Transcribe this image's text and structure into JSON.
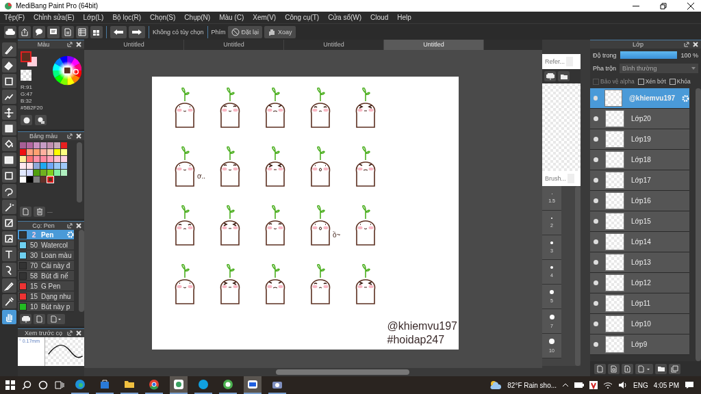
{
  "window": {
    "title": "MediBang Paint Pro (64bit)"
  },
  "menu": [
    "Tệp(F)",
    "Chỉnh sửa(E)",
    "Lớp(L)",
    "Bộ lọc(R)",
    "Chọn(S)",
    "Chụp(N)",
    "Màu (C)",
    "Xem(V)",
    "Công cụ(T)",
    "Cửa sổ(W)",
    "Cloud",
    "Help"
  ],
  "toolbar": {
    "option_text": "Không có tùy chọn",
    "key_label": "Phím",
    "reset_button": "Đặt lại",
    "rotate_button": "Xoay"
  },
  "document_tabs": [
    {
      "label": "Untitled",
      "selected": false
    },
    {
      "label": "Untitled",
      "selected": false
    },
    {
      "label": "Untitled",
      "selected": false
    },
    {
      "label": "Untitled",
      "selected": true
    }
  ],
  "tools": [
    {
      "kind": "brush",
      "selected": false
    },
    {
      "kind": "eraser",
      "selected": false
    },
    {
      "kind": "square",
      "selected": false
    },
    {
      "kind": "polyline",
      "selected": false
    },
    {
      "kind": "move",
      "selected": false
    },
    {
      "kind": "filled",
      "selected": false
    },
    {
      "kind": "bucket",
      "selected": false
    },
    {
      "kind": "gradient",
      "selected": false
    },
    {
      "kind": "selection",
      "selected": false
    },
    {
      "kind": "lasso",
      "selected": false
    },
    {
      "kind": "wand",
      "selected": false
    },
    {
      "kind": "selectpen",
      "selected": false
    },
    {
      "kind": "selecteraser",
      "selected": false
    },
    {
      "kind": "text",
      "selected": false
    },
    {
      "kind": "pointer",
      "selected": false
    },
    {
      "kind": "knife",
      "selected": false
    },
    {
      "kind": "dropper",
      "selected": false
    },
    {
      "kind": "hand",
      "selected": true
    }
  ],
  "color_panel": {
    "title": "Màu",
    "rgb": [
      "R:91",
      "G:47",
      "B:32"
    ],
    "hex": "#5B2F20"
  },
  "palette_panel": {
    "title": "Bảng màu",
    "footer": "---",
    "swatches": [
      {
        "color": "#a65f95",
        "selected": false
      },
      {
        "color": "#b266a0",
        "selected": false
      },
      {
        "color": "#c98fbf",
        "selected": false
      },
      {
        "color": "#c59bc4",
        "selected": false
      },
      {
        "color": "#c08fb0",
        "selected": false
      },
      {
        "color": "#c8a8b8",
        "selected": false
      },
      {
        "color": "#e82020",
        "selected": false
      },
      {
        "color": "#ee1111",
        "selected": false
      },
      {
        "color": "#ffa080",
        "selected": false
      },
      {
        "color": "#ffa070",
        "selected": false
      },
      {
        "color": "#ffb0a0",
        "selected": false
      },
      {
        "color": "#ffd0b0",
        "selected": false
      },
      {
        "color": "#ffff00",
        "selected": false
      },
      {
        "color": "#ffff80",
        "selected": false
      },
      {
        "color": "#ffee99",
        "selected": false
      },
      {
        "color": "#ff7070",
        "selected": false
      },
      {
        "color": "#ff90a8",
        "selected": false
      },
      {
        "color": "#ff88a0",
        "selected": false
      },
      {
        "color": "#ffa0b8",
        "selected": false
      },
      {
        "color": "#ffc0d0",
        "selected": false
      },
      {
        "color": "#ffd0e0",
        "selected": false
      },
      {
        "color": "#ffe8f0",
        "selected": false
      },
      {
        "color": "#ffe0e8",
        "selected": false
      },
      {
        "color": "#8ea8d8",
        "selected": false
      },
      {
        "color": "#20a8f0",
        "selected": false
      },
      {
        "color": "#70a8f8",
        "selected": false
      },
      {
        "color": "#98c8f8",
        "selected": false
      },
      {
        "color": "#a0c8f8",
        "selected": false
      },
      {
        "color": "#e0e8ff",
        "selected": false
      },
      {
        "color": "#d0d8ff",
        "selected": false
      },
      {
        "color": "#50a010",
        "selected": false
      },
      {
        "color": "#70b020",
        "selected": false
      },
      {
        "color": "#80d020",
        "selected": false
      },
      {
        "color": "#80f0a0",
        "selected": false
      },
      {
        "color": "#b0f0c0",
        "selected": false
      },
      {
        "color": "#ffffff",
        "selected": false
      },
      {
        "color": "#000000",
        "selected": false
      },
      {
        "color": "#808080",
        "selected": false
      },
      {
        "color": "#603028",
        "selected": false
      },
      {
        "color": "#5b2f20",
        "selected": true
      }
    ]
  },
  "brush_panel": {
    "title": "Cọ: Pen",
    "brushes": [
      {
        "size": "2",
        "name": "Pen",
        "color": "#333333",
        "selected": true
      },
      {
        "size": "50",
        "name": "Watercol",
        "color": "#6fd0f0",
        "selected": false
      },
      {
        "size": "30",
        "name": "Loan màu",
        "color": "#6fd0f0",
        "selected": false
      },
      {
        "size": "70",
        "name": "Cái này đ",
        "color": "#333333",
        "selected": false
      },
      {
        "size": "58",
        "name": "Bút đi nế",
        "color": "#333333",
        "selected": false
      },
      {
        "size": "15",
        "name": "G Pen",
        "color": "#ee3333",
        "selected": false
      },
      {
        "size": "15",
        "name": "Dạng nhu",
        "color": "#ee3333",
        "selected": false
      },
      {
        "size": "10",
        "name": "Bút này p",
        "color": "#22bb22",
        "selected": false
      }
    ]
  },
  "brush_preview": {
    "title": "Xem trước cọ",
    "size": "° 0.17mm"
  },
  "reference_panel": {
    "title": "Refer..."
  },
  "brush_size_panel": {
    "title": "Brush...",
    "sizes": [
      "1.5",
      "2",
      "3",
      "4",
      "5",
      "7",
      "10"
    ]
  },
  "canvas": {
    "figures": [
      {
        "kind": "smile"
      },
      {
        "kind": "blush"
      },
      {
        "kind": "angry"
      },
      {
        "kind": "sad"
      },
      {
        "kind": "squint"
      },
      {
        "kind": "smile",
        "caption": "ơ.."
      },
      {
        "kind": "blush"
      },
      {
        "kind": "squint"
      },
      {
        "kind": "surprised"
      },
      {
        "kind": "angry"
      },
      {
        "kind": "sad"
      },
      {
        "kind": "squint"
      },
      {
        "kind": "blush"
      },
      {
        "kind": "surprised",
        "caption": "ồ~"
      },
      {
        "kind": "smile"
      },
      {
        "kind": "smile"
      },
      {
        "kind": "squint"
      },
      {
        "kind": "angry"
      },
      {
        "kind": "sad"
      },
      {
        "kind": "squint"
      }
    ],
    "signature": [
      "@khiemvu197",
      "#hoidap247"
    ]
  },
  "layer_panel": {
    "title": "Lớp",
    "opacity_label": "Độ trong",
    "opacity": {
      "level": 1
    },
    "opacity_value": "100 %",
    "blend_label": "Pha trộn",
    "blend_value": "Bình thường",
    "options": [
      {
        "label": "Bảo vệ alpha",
        "checked": false,
        "disabled": true
      },
      {
        "label": "Xén bớt",
        "checked": false,
        "disabled": false
      },
      {
        "label": "Khóa",
        "checked": false,
        "disabled": false
      }
    ],
    "layers": [
      {
        "name": "@khiemvu197",
        "selected": true,
        "visible": true
      },
      {
        "name": "Lớp20",
        "selected": false,
        "visible": true
      },
      {
        "name": "Lớp19",
        "selected": false,
        "visible": true
      },
      {
        "name": "Lớp18",
        "selected": false,
        "visible": true
      },
      {
        "name": "Lớp17",
        "selected": false,
        "visible": true
      },
      {
        "name": "Lớp16",
        "selected": false,
        "visible": true
      },
      {
        "name": "Lớp15",
        "selected": false,
        "visible": true
      },
      {
        "name": "Lớp14",
        "selected": false,
        "visible": true
      },
      {
        "name": "Lớp13",
        "selected": false,
        "visible": true
      },
      {
        "name": "Lớp12",
        "selected": false,
        "visible": true
      },
      {
        "name": "Lớp11",
        "selected": false,
        "visible": true
      },
      {
        "name": "Lớp10",
        "selected": false,
        "visible": true
      },
      {
        "name": "Lớp9",
        "selected": false,
        "visible": true
      }
    ]
  },
  "taskbar": {
    "apps": [
      {
        "kind": "edge",
        "selected": false
      },
      {
        "kind": "store",
        "selected": false
      },
      {
        "kind": "folder",
        "selected": false
      },
      {
        "kind": "chrome",
        "selected": false
      },
      {
        "kind": "paint",
        "selected": true
      },
      {
        "kind": "skype",
        "selected": false
      },
      {
        "kind": "ring",
        "selected": false
      },
      {
        "kind": "zalo",
        "selected": true
      },
      {
        "kind": "camera",
        "selected": false
      }
    ],
    "weather": "82°F  Rain sho...",
    "language": "ENG",
    "time": "4:05 PM"
  }
}
